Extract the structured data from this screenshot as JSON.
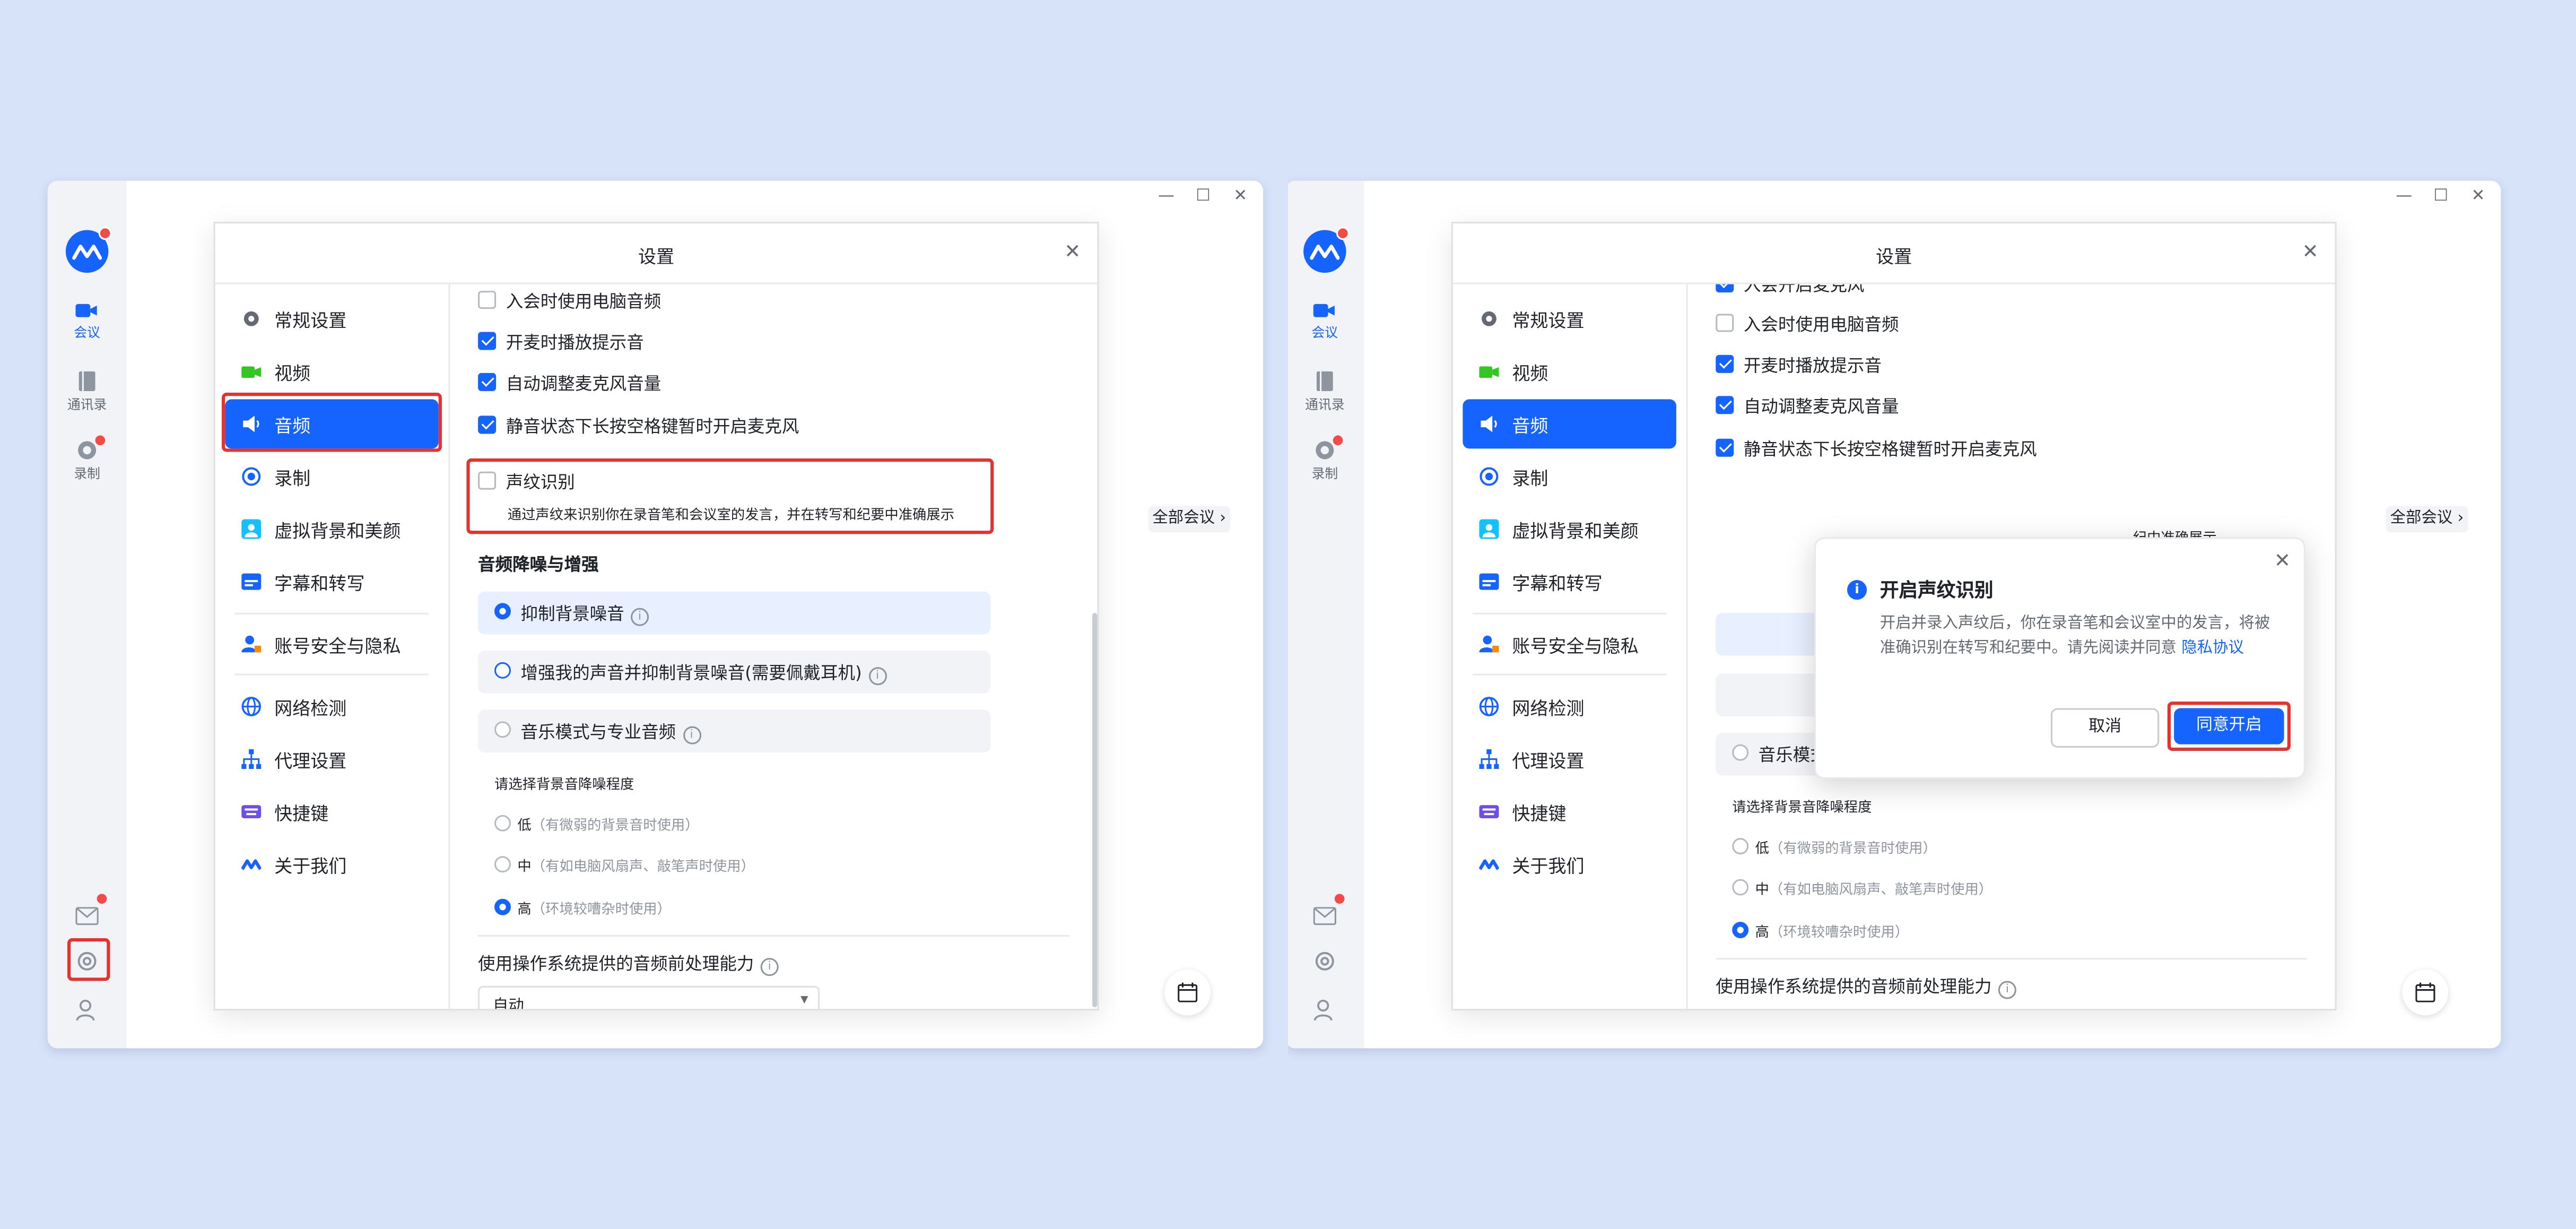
{
  "left": {
    "rail": {
      "meeting": "会议",
      "contacts": "通讯录",
      "record": "录制"
    },
    "dialog_title": "设置",
    "nav": [
      "常规设置",
      "视频",
      "音频",
      "录制",
      "虚拟背景和美颜",
      "字幕和转写",
      "账号安全与隐私",
      "网络检测",
      "代理设置",
      "快捷键",
      "关于我们"
    ],
    "checks": [
      "入会时使用电脑音频",
      "开麦时播放提示音",
      "自动调整麦克风音量",
      "静音状态下长按空格键暂时开启麦克风"
    ],
    "voiceprint": {
      "label": "声纹识别",
      "desc": "通过声纹来识别你在录音笔和会议室的发言，并在转写和纪要中准确展示"
    },
    "noise_title": "音频降噪与增强",
    "options": [
      "抑制背景噪音",
      "增强我的声音并抑制背景噪音(需要佩戴耳机)",
      "音乐模式与专业音频"
    ],
    "level_title": "请选择背景音降噪程度",
    "levels": [
      {
        "name": "低",
        "hint": "（有微弱的背景音时使用）"
      },
      {
        "name": "中",
        "hint": "（有如电脑风扇声、敲笔声时使用）"
      },
      {
        "name": "高",
        "hint": "（环境较嘈杂时使用）"
      }
    ],
    "os_title": "使用操作系统提供的音频前处理能力",
    "select_value": "自动",
    "all_meetings": "全部会议"
  },
  "right": {
    "rail": {
      "meeting": "会议",
      "contacts": "通讯录",
      "record": "录制"
    },
    "dialog_title": "设置",
    "nav": [
      "常规设置",
      "视频",
      "音频",
      "录制",
      "虚拟背景和美颜",
      "字幕和转写",
      "账号安全与隐私",
      "网络检测",
      "代理设置",
      "快捷键",
      "关于我们"
    ],
    "checks_partial": "入会开启麦克风",
    "checks": [
      "入会时使用电脑音频",
      "开麦时播放提示音",
      "自动调整麦克风音量",
      "静音状态下长按空格键暂时开启麦克风"
    ],
    "desc_tail": "纪中准确展示",
    "option3": "音乐模式与专业音频",
    "level_title": "请选择背景音降噪程度",
    "levels": [
      {
        "name": "低",
        "hint": "（有微弱的背景音时使用）"
      },
      {
        "name": "中",
        "hint": "（有如电脑风扇声、敲笔声时使用）"
      },
      {
        "name": "高",
        "hint": "（环境较嘈杂时使用）"
      }
    ],
    "os_title": "使用操作系统提供的音频前处理能力",
    "all_meetings": "全部会议",
    "popup": {
      "title": "开启声纹识别",
      "body": "开启并录入声纹后，你在录音笔和会议室中的发言，将被准确识别在转写和纪要中。请先阅读并同意 ",
      "link": "隐私协议",
      "cancel": "取消",
      "confirm": "同意开启"
    }
  },
  "colors": {
    "accent": "#1664ff",
    "highlight": "#e5322e",
    "background": "#d7e3f9"
  }
}
